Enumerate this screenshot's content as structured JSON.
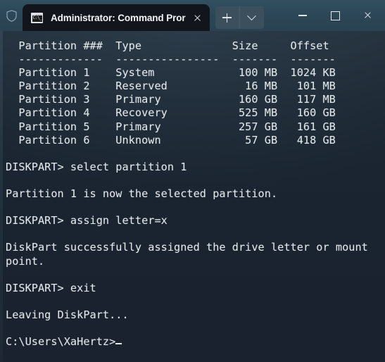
{
  "window": {
    "shield_icon": "shield-icon",
    "minimize_label": "—",
    "maximize_label": "□",
    "close_label": "✕"
  },
  "tabbar": {
    "tab_title": "Administrator: Command Pror",
    "tab_icon_text": "C:\\_",
    "tab_close_label": "✕",
    "new_tab_label": "+",
    "dropdown_label": "⌄"
  },
  "terminal": {
    "prompt_cwd": "C:\\Users\\XaHertz>",
    "lines": [
      "  Partition ###  Type              Size     Offset",
      "  -------------  ----------------  -------  -------",
      "  Partition 1    System             100 MB  1024 KB",
      "  Partition 2    Reserved            16 MB   101 MB",
      "  Partition 3    Primary            160 GB   117 MB",
      "  Partition 4    Recovery           525 MB   160 GB",
      "  Partition 5    Primary            257 GB   161 GB",
      "  Partition 6    Unknown             57 GB   418 GB",
      "",
      "DISKPART> select partition 1",
      "",
      "Partition 1 is now the selected partition.",
      "",
      "DISKPART> assign letter=x",
      "",
      "DiskPart successfully assigned the drive letter or mount",
      "point.",
      "",
      "DISKPART> exit",
      "",
      "Leaving DiskPart...",
      ""
    ],
    "partition_table": {
      "headers": [
        "Partition ###",
        "Type",
        "Size",
        "Offset"
      ],
      "rows": [
        [
          "Partition 1",
          "System",
          "100 MB",
          "1024 KB"
        ],
        [
          "Partition 2",
          "Reserved",
          "16 MB",
          "101 MB"
        ],
        [
          "Partition 3",
          "Primary",
          "160 GB",
          "117 MB"
        ],
        [
          "Partition 4",
          "Recovery",
          "525 MB",
          "160 GB"
        ],
        [
          "Partition 5",
          "Primary",
          "257 GB",
          "161 GB"
        ],
        [
          "Partition 6",
          "Unknown",
          "57 GB",
          "418 GB"
        ]
      ]
    },
    "commands": [
      "select partition 1",
      "assign letter=x",
      "exit"
    ],
    "messages": [
      "Partition 1 is now the selected partition.",
      "DiskPart successfully assigned the drive letter or mount point.",
      "Leaving DiskPart..."
    ]
  },
  "colors": {
    "titlebar": "#2c4656",
    "tab_active": "#12161c",
    "terminal_bg": "#1a2330",
    "text": "#e2e7ea",
    "button_bg": "#3b4f5c"
  }
}
